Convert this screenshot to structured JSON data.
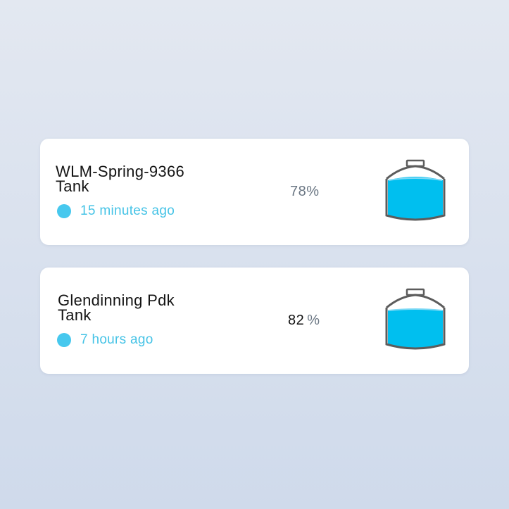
{
  "tanks": [
    {
      "name": "WLM-Spring-9366\nTank",
      "last_seen": "15 minutes ago",
      "level_text": "78%",
      "level_fraction": 0.78,
      "status_color": "#47c8ee",
      "icon": "water-tank-icon"
    },
    {
      "name": "Glendinning Pdk\nTank",
      "last_seen": "7 hours ago",
      "level_value": "82",
      "level_unit": "%",
      "level_fraction": 0.82,
      "status_color": "#47c8ee",
      "icon": "water-tank-icon"
    }
  ],
  "colors": {
    "water": "#00bfef",
    "tank_outline": "#5c5c5c",
    "accent": "#45c3e6"
  }
}
